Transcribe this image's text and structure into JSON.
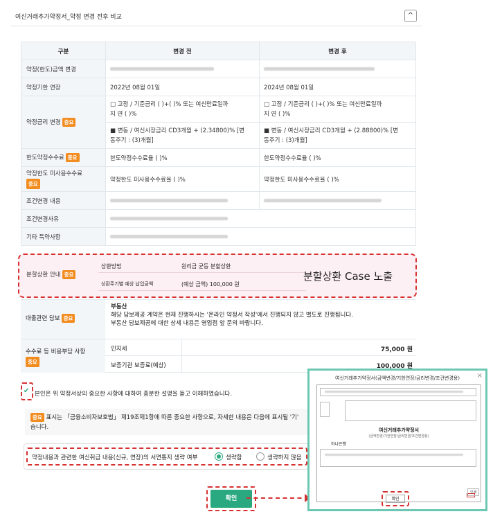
{
  "header": {
    "title": "여신거래추가약정서_약정 변경 전후 비교",
    "collapse_icon": "^"
  },
  "table": {
    "headers": [
      "구분",
      "변경 전",
      "변경 후"
    ],
    "rows": {
      "limit_change": "약정(한도)금액 변경",
      "term_ext": "약정기한 연장",
      "term_before": "2022년 08월 01일",
      "term_after": "2024년 08월 01일",
      "rate_change": "약정금리 변경",
      "rate_fixed_before_1": "□ 고정 / 기준금리 (      )+(      )% 또는 여신만료일까",
      "rate_fixed_before_2": "지 연 (      )%",
      "rate_fixed_after_1": "□ 고정 / 기준금리 (      )+(      )% 또는 여신만료일까",
      "rate_fixed_after_2": "지 연 (      )%",
      "rate_var_before_1": "■ 변동 / 여신시장금리 CD3개월 + (2.34800)% [변",
      "rate_var_before_2": "동주기 : (3)개월]",
      "rate_var_after_1": "■ 변동 / 여신시장금리 CD3개월 + (2.88800)% [변",
      "rate_var_after_2": "동주기 : (3)개월]",
      "limit_fee": "한도약정수수료",
      "limit_fee_before": "한도약정수수료율 (                )%",
      "limit_fee_after": "한도약정수수료율 (                )%",
      "unused_fee": "약정한도 미사용수수료",
      "unused_fee_before": "약정한도 미사용수수료율 (                )%",
      "unused_fee_after": "약정한도 미사용수수료율 (                )%",
      "cond_change": "조건변경 내용",
      "cond_reason": "조건변경사유",
      "other": "기타 특약사항"
    },
    "badge": "중요"
  },
  "installment": {
    "label": "분할상환 안내",
    "method_label": "상환방법",
    "method_value": "원리금 균등 분할상환",
    "amount_label": "상환주기별 예상 납입금액",
    "amount_value": "(예상 금액) 100,000 원",
    "callout": "분할상환 Case 노출"
  },
  "collateral": {
    "label": "대출관련 담보",
    "title": "부동산",
    "line1": "해당 담보제공 계약은 현재 진행하시는 '온라인 약정서 작성'에서 진행되지 않고 별도로 진행됩니다.",
    "line2": "부동산 담보제공에 대한 상세 내용은 영업점 앞 문의 바랍니다."
  },
  "fees": {
    "label": "수수료 등 비용부담 사항",
    "stamp_label": "인지세",
    "stamp_value": "75,000 원",
    "guarantee_label": "보증기관 보증료(예상)",
    "guarantee_value": "100,000 원"
  },
  "consent": "본인은 위 약정서상의 중요한 사항에 대하여 충분한 설명을 듣고 이해하였습니다.",
  "notice_1": "표시는 「금융소비자보호법」 제19조제1항에 따른 중요한 사항으로, 자세한 내용은 다음에 표시될 '기'",
  "notice_2": "습니다.",
  "omission": {
    "question": "약정내용과 관련한 여신취급 내용(신규, 연장)의 서면통지 생략 여부",
    "opt_omit": "생략함",
    "opt_no_omit": "생략하지 않음"
  },
  "confirm_button": "확인",
  "popup": {
    "title": "여신거래추가약정서(금액변경/기한연장/금리변경/조건변경용)",
    "close": "×",
    "doc_title": "여신거래추가약정서",
    "doc_subtitle": "(금액변경/기한연장/금리변경/조건변경용)",
    "bank": "하나은행",
    "ok": "확인",
    "side": "인쇄"
  }
}
